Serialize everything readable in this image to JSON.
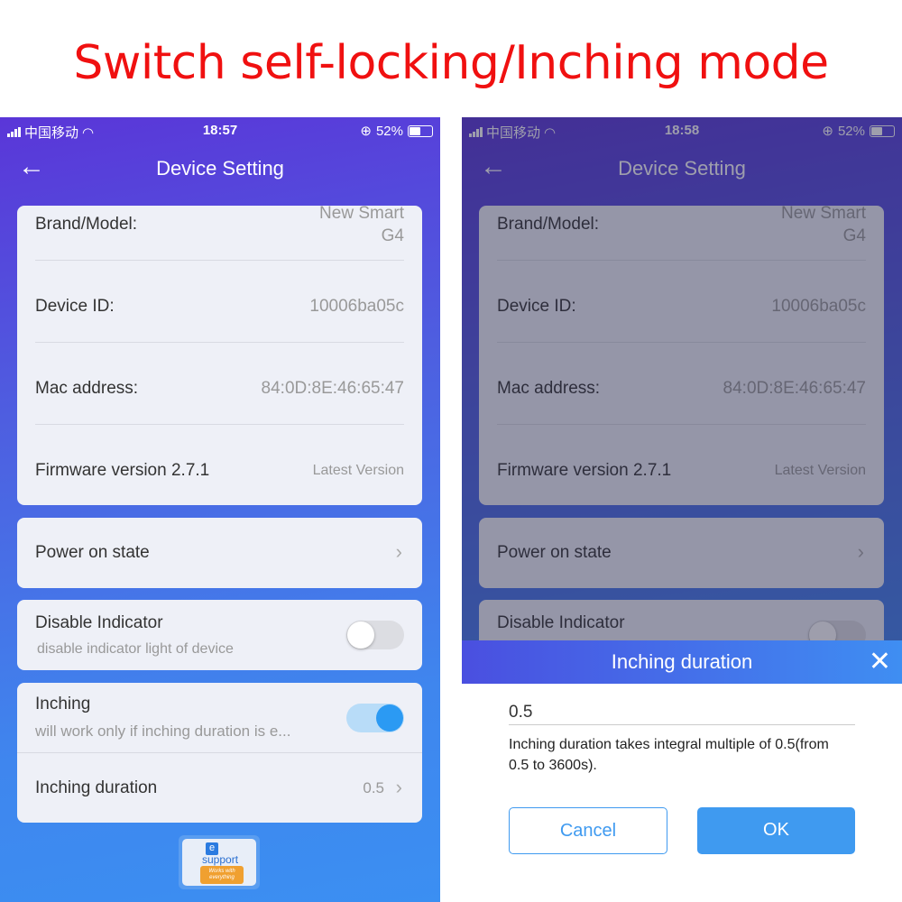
{
  "headline": "Switch self-locking/Inching mode",
  "left": {
    "status": {
      "carrier": "中国移动",
      "time": "18:57",
      "battery": "52%",
      "battery_level": 0.52
    },
    "nav": {
      "back": "←",
      "title": "Device Setting"
    },
    "info": {
      "brand_label": "Brand/Model:",
      "brand_value_1": "New Smart",
      "brand_value_2": "G4",
      "id_label": "Device ID:",
      "id_value": "10006ba05c",
      "mac_label": "Mac address:",
      "mac_value": "84:0D:8E:46:65:47",
      "fw_label": "Firmware version 2.7.1",
      "fw_value": "Latest Version"
    },
    "power_on": "Power on state",
    "indicator": {
      "label": "Disable Indicator",
      "sub": "disable indicator light of device",
      "enabled": false
    },
    "inching": {
      "label": "Inching",
      "sub": "will work only if inching duration is e...",
      "enabled": true,
      "duration_label": "Inching duration",
      "duration_value": "0.5"
    },
    "logo": {
      "e": "e",
      "brand": "support",
      "tag": "Works with everything"
    }
  },
  "right": {
    "status": {
      "carrier": "中国移动",
      "time": "18:58",
      "battery": "52%",
      "battery_level": 0.52
    },
    "nav": {
      "back": "←",
      "title": "Device Setting"
    },
    "info": {
      "brand_label": "Brand/Model:",
      "brand_value_1": "New Smart",
      "brand_value_2": "G4",
      "id_label": "Device ID:",
      "id_value": "10006ba05c",
      "mac_label": "Mac address:",
      "mac_value": "84:0D:8E:46:65:47",
      "fw_label": "Firmware version 2.7.1",
      "fw_value": "Latest Version"
    },
    "power_on": "Power on state",
    "indicator": {
      "label": "Disable Indicator",
      "sub": "",
      "enabled": false
    },
    "dialog": {
      "title": "Inching duration",
      "value": "0.5",
      "hint": "Inching duration takes integral multiple of 0.5(from 0.5 to 3600s).",
      "cancel": "Cancel",
      "ok": "OK"
    }
  },
  "colors": {
    "headline": "#f01010",
    "accent": "#3f9af0",
    "toggle_on": "#2b9af3"
  }
}
